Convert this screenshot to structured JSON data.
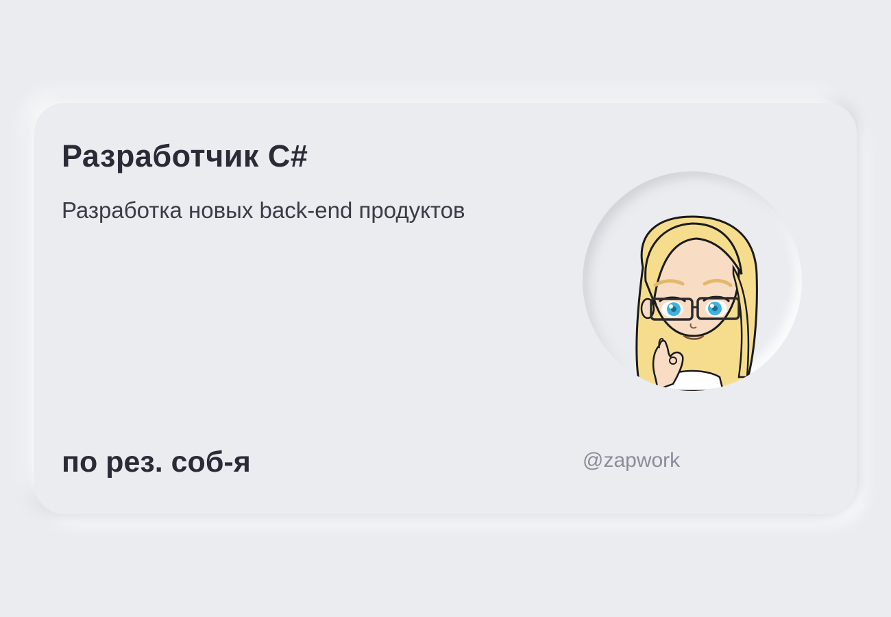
{
  "card": {
    "title": "Разработчик C#",
    "description": "Разработка новых back-end продуктов",
    "salary": "по рез. соб-я",
    "handle": "@zapwork"
  },
  "avatar": {
    "icon": "cartoon-girl-avatar",
    "hair_color": "#f6dd8e",
    "skin_color": "#f8dcc4",
    "eye_color": "#3fb3dc"
  },
  "colors": {
    "background": "#ebecf0",
    "text_dark": "#2a2b36",
    "text_muted": "#8a8c99"
  }
}
